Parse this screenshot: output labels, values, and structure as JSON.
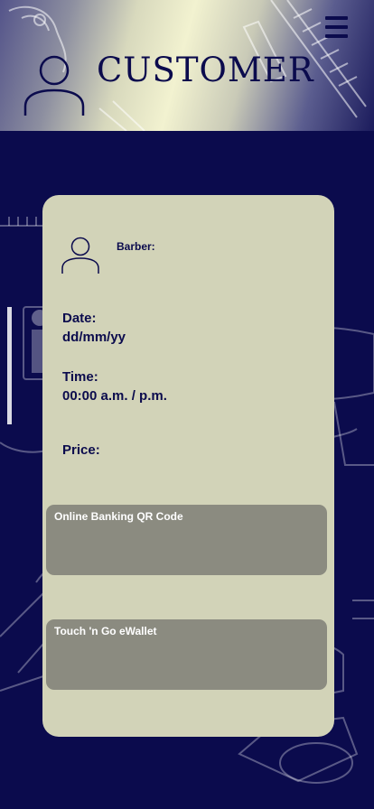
{
  "header": {
    "title": "CUSTOMER",
    "menu_icon": "hamburger-menu-icon",
    "avatar_icon": "user-avatar-icon"
  },
  "booking": {
    "barber_label": "Barber:",
    "date_label": "Date:",
    "date_value": "dd/mm/yy",
    "time_label": "Time:",
    "time_value": "00:00 a.m. / p.m.",
    "price_label": "Price:"
  },
  "payment": {
    "online_banking_label": "Online Banking QR Code",
    "ewallet_label": "Touch 'n Go eWallet"
  },
  "colors": {
    "navy": "#0b0b4d",
    "card": "#d2d3b8",
    "pay_box": "#8b8b80"
  }
}
